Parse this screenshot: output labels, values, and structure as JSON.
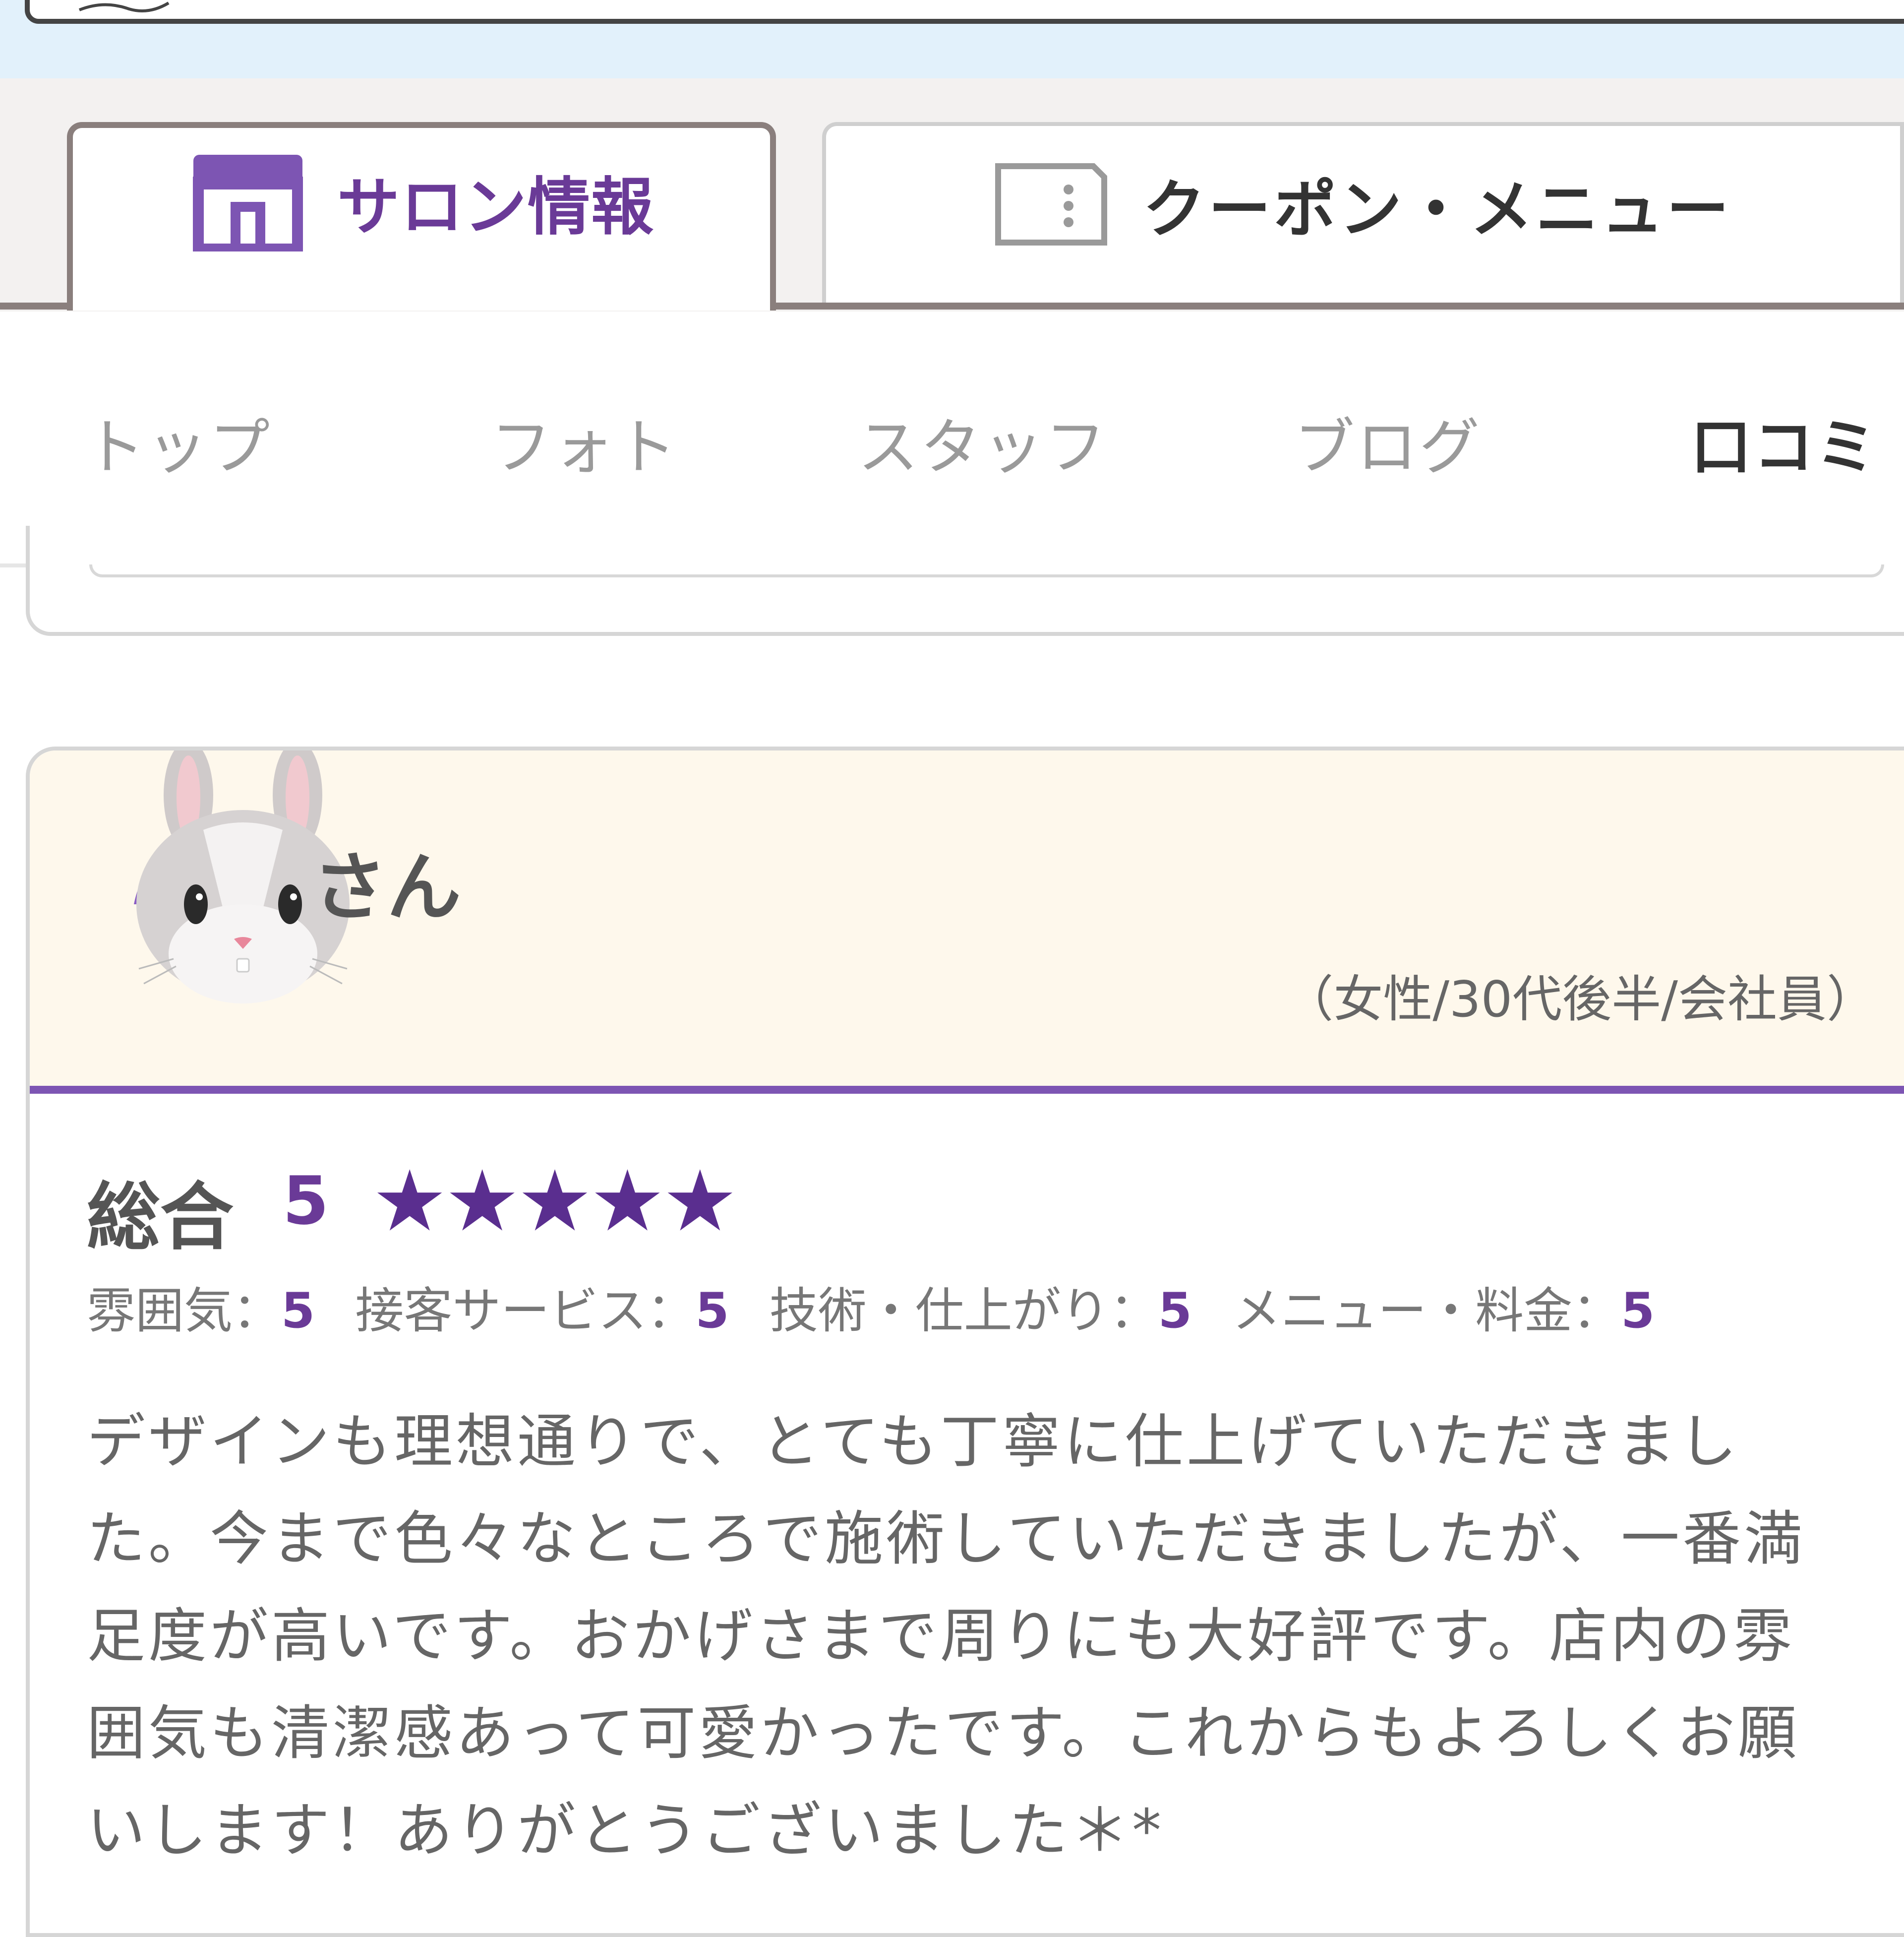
{
  "colors": {
    "accent_purple": "#6a3a97",
    "tab_border": "#8a7f7d",
    "header_bg": "#fef8ec",
    "top_band": "#e2f1fb"
  },
  "main_tabs": [
    {
      "label": "サロン情報",
      "icon": "storefront-icon",
      "active": true
    },
    {
      "label": "クーポン・メニュー",
      "icon": "coupon-ticket-icon",
      "active": false
    }
  ],
  "sub_nav": [
    {
      "label": "トップ",
      "active": false
    },
    {
      "label": "フォト",
      "active": false
    },
    {
      "label": "スタッフ",
      "active": false
    },
    {
      "label": "ブログ",
      "active": false
    },
    {
      "label": "口コミ",
      "active": true
    }
  ],
  "review": {
    "avatar": "rabbit-face-icon",
    "username_suffix": "さん",
    "profile": "（女性/30代後半/会社員）",
    "overall_label": "総合",
    "overall_score": "5",
    "stars": "★★★★★",
    "subscores": [
      {
        "label": "雰囲気：",
        "score": "5"
      },
      {
        "label": "接客サービス：",
        "score": "5"
      },
      {
        "label": "技術・仕上がり：",
        "score": "5"
      },
      {
        "label": "メニュー・料金：",
        "score": "5"
      }
    ],
    "text_lines": [
      "デザインも理想通りで、とても丁寧に仕上げていただきまし",
      "た。今まで色々なところで施術していただきましたが、一番満",
      "足度が高いです。おかげさまで周りにも大好評です。店内の雰",
      "囲気も清潔感あって可愛かったです。これからもよろしくお願",
      "いします！ありがとうございました＊*"
    ]
  }
}
